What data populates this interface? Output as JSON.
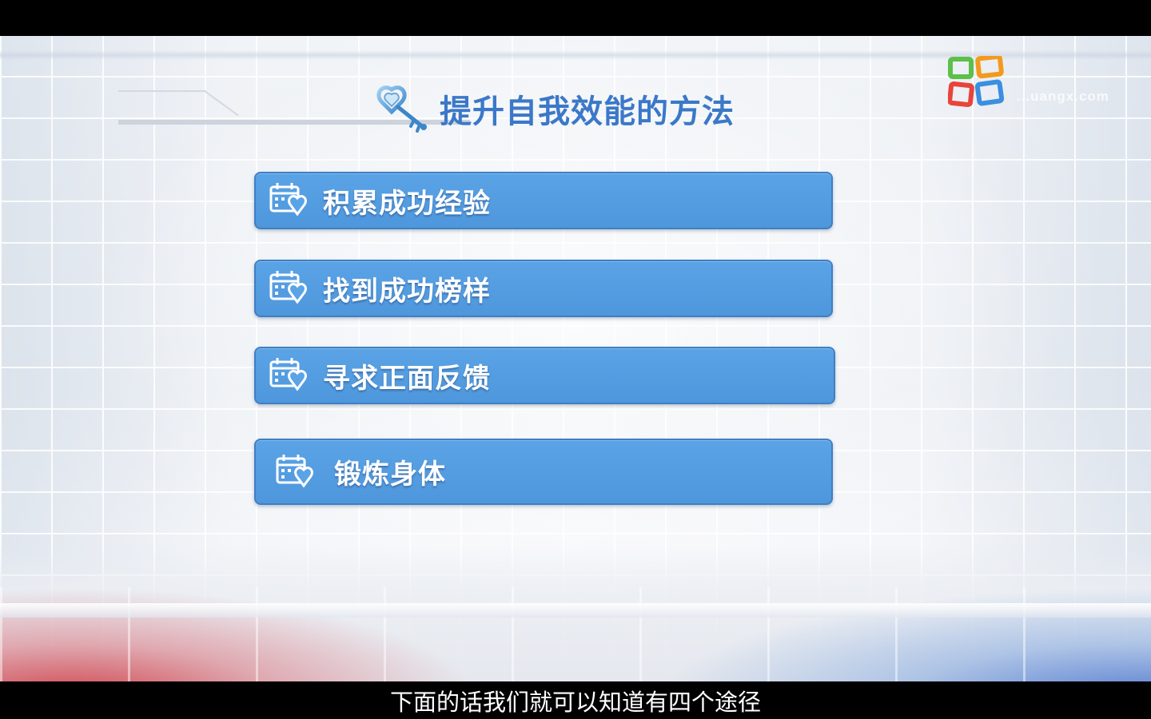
{
  "logo": {
    "name": "logo-icon",
    "watermark": "...uangx.com"
  },
  "slide": {
    "title": "提升自我效能的方法",
    "items": [
      {
        "label": "积累成功经验",
        "icon": "calendar-heart-icon"
      },
      {
        "label": "找到成功榜样",
        "icon": "calendar-heart-icon"
      },
      {
        "label": "寻求正面反馈",
        "icon": "calendar-heart-icon"
      },
      {
        "label": "锻炼身体",
        "icon": "calendar-heart-icon"
      }
    ]
  },
  "subtitle": "下面的话我们就可以知道有四个途径",
  "colors": {
    "accent_blue": "#3b78c8",
    "button_blue": "#5aa3e6",
    "logo_green": "#5cc04a",
    "logo_orange": "#f39a1e",
    "logo_red": "#e8443a",
    "logo_blue": "#3a8fe0"
  }
}
